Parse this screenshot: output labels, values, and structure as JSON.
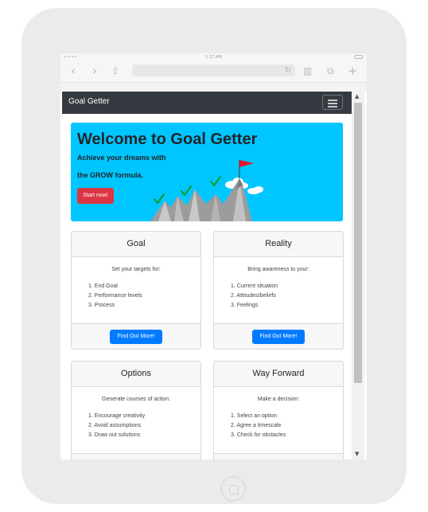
{
  "status_bar": {
    "signal": "•••••",
    "time": "1:17 AM"
  },
  "browser": {
    "icons": {
      "back": "chevron-left-icon",
      "forward": "chevron-right-icon",
      "share": "share-icon",
      "reload": "reload-icon",
      "reader": "book-icon",
      "tabs": "tabs-icon",
      "new_tab": "plus-icon"
    }
  },
  "navbar": {
    "brand": "Goal Getter",
    "toggler_icon": "hamburger-icon"
  },
  "hero": {
    "title": "Welcome to Goal Getter",
    "lead_line1": "Achieve your dreams with",
    "lead_line2": "the GROW formula.",
    "button": "Start now!",
    "colors": {
      "background": "#00c6ff",
      "button": "#dc3545",
      "flag": "#e8132b",
      "checks": "#0a9a2a"
    }
  },
  "cards": [
    {
      "title": "Goal",
      "intro": "Set your targets for:",
      "items": [
        "1. End Goal",
        "2. Performance levels",
        "3. Process"
      ],
      "button": "Find Out More!"
    },
    {
      "title": "Reality",
      "intro": "Bring awareness to your:",
      "items": [
        "1. Current situation",
        "2. Attitudes/beliefs",
        "3. Feelings"
      ],
      "button": "Find Out More!"
    },
    {
      "title": "Options",
      "intro": "Generate courses of action:",
      "items": [
        "1. Encourage creativity",
        "2. Avoid assumptions",
        "3. Draw out solutions"
      ]
    },
    {
      "title": "Way Forward",
      "intro": "Make a decision:",
      "items": [
        "1. Select an option",
        "2. Agree a timescale",
        "3. Check for obstacles"
      ]
    }
  ],
  "colors": {
    "navbar": "#343a40",
    "primary": "#007bff"
  }
}
